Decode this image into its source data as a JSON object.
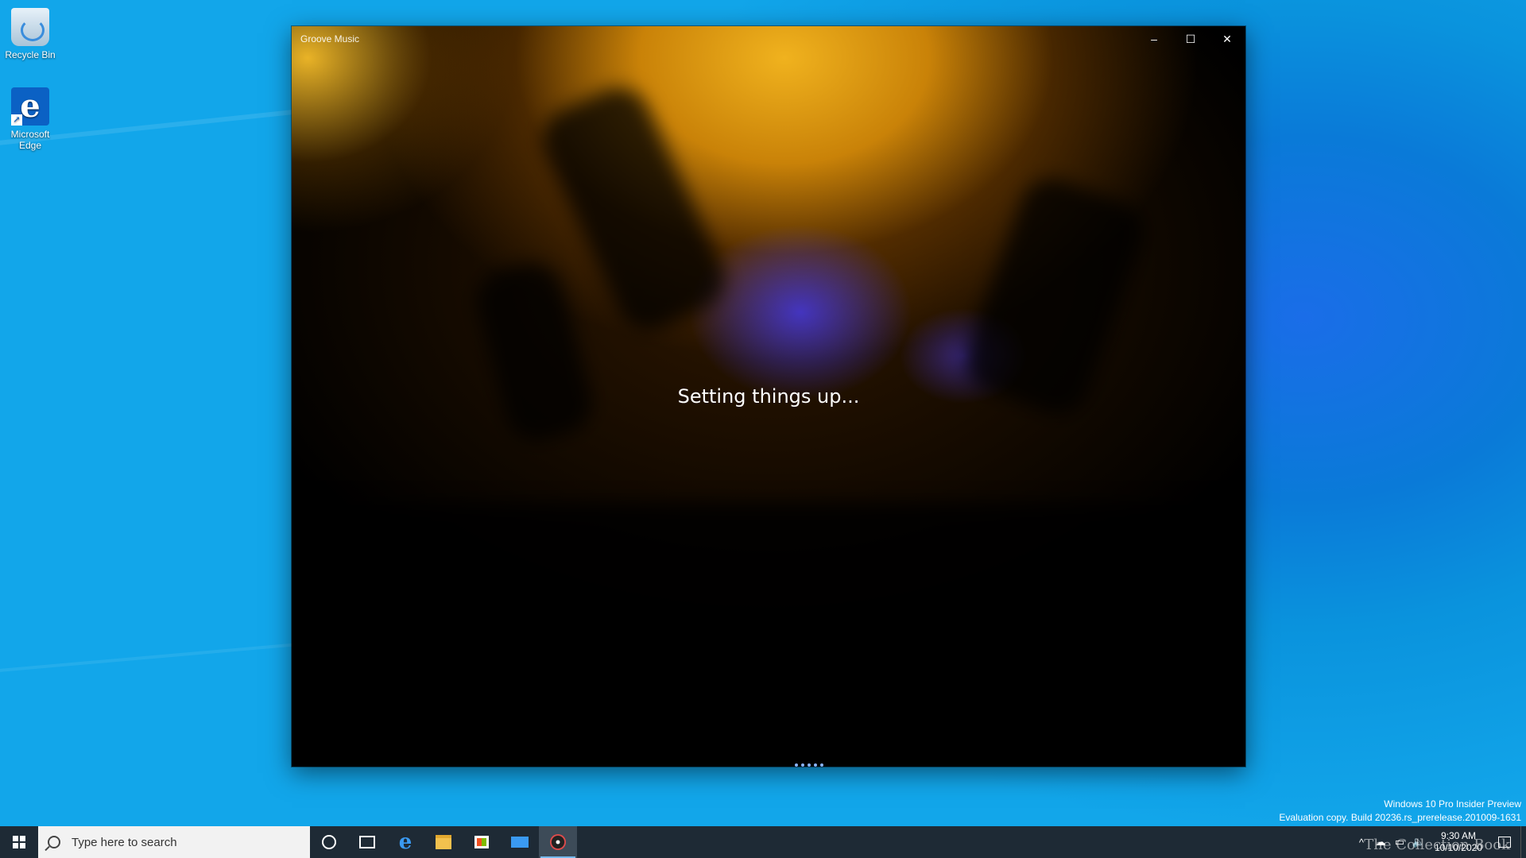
{
  "desktop": {
    "icons": [
      {
        "label": "Recycle Bin"
      },
      {
        "label": "Microsoft Edge"
      }
    ],
    "watermark": {
      "line1": "Windows 10 Pro Insider Preview",
      "line2": "Evaluation copy. Build 20236.rs_prerelease.201009-1631"
    },
    "overlay_logo": "The Collection Book"
  },
  "window": {
    "title": "Groove Music",
    "status_text": "Setting things up...",
    "caption_buttons": {
      "minimize": "–",
      "maximize": "☐",
      "close": "✕"
    }
  },
  "taskbar": {
    "search_placeholder": "Type here to search",
    "pinned": [
      "start-icon",
      "cortana-icon",
      "task-view-icon",
      "edge-icon",
      "file-explorer-icon",
      "store-icon",
      "mail-icon",
      "groove-music-icon"
    ],
    "tray": {
      "chevron": "^",
      "time": "9:30 AM",
      "date": "10/10/2020"
    }
  },
  "colors": {
    "desktop_blue": "#0a7ad8",
    "taskbar": "#1e2a35",
    "accent": "#76b9ed"
  }
}
